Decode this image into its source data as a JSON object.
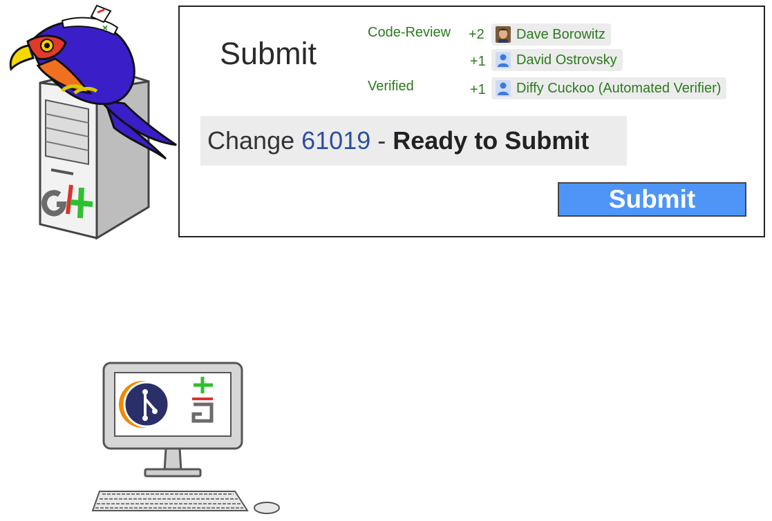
{
  "review": {
    "title": "Submit",
    "labels": [
      {
        "name": "Code-Review",
        "votes": [
          {
            "value": "+2",
            "reviewer": "Dave Borowitz",
            "avatar": "photo-avatar"
          },
          {
            "value": "+1",
            "reviewer": "David Ostrovsky",
            "avatar": "default-avatar"
          }
        ]
      },
      {
        "name": "Verified",
        "votes": [
          {
            "value": "+1",
            "reviewer": "Diffy Cuckoo (Automated Verifier)",
            "avatar": "default-avatar"
          }
        ]
      }
    ],
    "change": {
      "prefix": "Change",
      "number": "61019",
      "separator": "-",
      "state": "Ready to Submit"
    },
    "submit_button": "Submit"
  },
  "illustrations": {
    "server_logo_text": "GI+",
    "desktop_logo_text": "GI+"
  },
  "colors": {
    "label_green": "#2b7a1e",
    "change_number_blue": "#2b4ea0",
    "button_blue": "#4e95f7",
    "chip_background": "#ececec",
    "gerrit_red": "#e03030",
    "gerrit_green": "#2fbf2f",
    "bird_purple": "#3a1fc8",
    "git_orange": "#f08a00",
    "git_navy": "#2a2f6a"
  }
}
